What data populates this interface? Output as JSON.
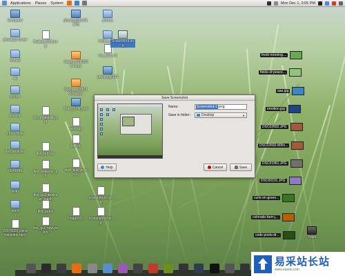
{
  "top_panel": {
    "menus": [
      "Applications",
      "Places",
      "System"
    ],
    "clock": "Mon Dec 1, 3:55 PM"
  },
  "desktop_icons": [
    {
      "label": "Computer",
      "kind": "blue"
    },
    {
      "label": "phuang's Home",
      "kind": "folder"
    },
    {
      "label": "home2",
      "kind": "folder"
    },
    {
      "label": "ali",
      "kind": "folder"
    },
    {
      "label": "google",
      "kind": "folder"
    },
    {
      "label": "new file",
      "kind": "folder"
    },
    {
      "label": "Linux Note",
      "kind": "folder"
    },
    {
      "label": "lkst_analyzer",
      "kind": "folder"
    },
    {
      "label": "README",
      "kind": "folder"
    },
    {
      "label": "WiKi",
      "kind": "folder"
    },
    {
      "label": "work",
      "kind": "folder"
    },
    {
      "label": "20070829 china transition mp3",
      "kind": "doc"
    },
    {
      "label": "Beijing-2008.png",
      "kind": "doc"
    },
    {
      "label": "Incompatibility.pdf",
      "kind": "doc"
    },
    {
      "label": "lkst_buf.csv",
      "kind": "doc"
    },
    {
      "label": "lkst_analyzer_ch",
      "kind": "doc"
    },
    {
      "label": "lkst_gui_analyzer_patch",
      "kind": "doc"
    },
    {
      "label": "lkst_patch",
      "kind": "doc"
    },
    {
      "label": "lkst_gui_new.patch",
      "kind": "doc"
    },
    {
      "label": "phuang@10.66.1.65",
      "kind": "blue"
    },
    {
      "label": "Sogou-20061102.tar.gz",
      "kind": "orange"
    },
    {
      "label": "Sogou_20061102.tar.gz",
      "kind": "orange"
    },
    {
      "label": "Start_SVN_tool",
      "kind": "blue"
    },
    {
      "label": "test.ogg",
      "kind": "doc"
    },
    {
      "label": "test.py",
      "kind": "doc"
    },
    {
      "label": "stuff_test_pywin.py",
      "kind": "doc"
    },
    {
      "label": "Tmag001...",
      "kind": "doc"
    },
    {
      "label": "photos",
      "kind": "folder"
    },
    {
      "label": "beijing_files",
      "kind": "folder"
    },
    {
      "label": "rss_test.xml",
      "kind": "doc"
    },
    {
      "label": "phuang@199",
      "kind": "blue"
    },
    {
      "label": "Screenshot.png",
      "kind": "img",
      "selected": true
    },
    {
      "label": "screenshot2.png",
      "kind": "doc"
    },
    {
      "label": "screenshot3.png",
      "kind": "doc"
    }
  ],
  "right_items": [
    {
      "label": "fresh-morning....",
      "color": "#6aa84f"
    },
    {
      "label": "fields-of-peace...",
      "color": "#93c47d"
    },
    {
      "label": "aaa.jpg",
      "color": "#3d85c6"
    },
    {
      "label": "emotion.jpg",
      "color": "#1c4587"
    },
    {
      "label": "DSC02692.JPG",
      "color": "#a05a3c"
    },
    {
      "label": "DSC02692-800x...",
      "color": "#a05a3c"
    },
    {
      "label": "DSC01961.JPG",
      "color": "#6f6f6f"
    },
    {
      "label": "DSC00101.JPG",
      "color": "#8e7cc3"
    },
    {
      "label": "curls-on-green...",
      "color": "#38761d"
    },
    {
      "label": "colorado-farm.j...",
      "color": "#b45f06"
    },
    {
      "label": "code-poets-dr...",
      "color": "#274e13"
    }
  ],
  "trash_label": "Trash",
  "dialog": {
    "title": "Save Screenshot",
    "name_label": "Name:",
    "name_selected": "Screenshot-1",
    "name_ext": ".png",
    "folder_label": "Save in folder:",
    "folder_value": "Desktop",
    "help_label": "Help",
    "cancel_label": "Cancel",
    "save_label": "Save"
  },
  "dock_items": [
    {
      "name": "dock-item-1",
      "color": "#555555"
    },
    {
      "name": "dock-item-2",
      "color": "#2b2b2b"
    },
    {
      "name": "dock-item-3",
      "color": "#3d3d3d"
    },
    {
      "name": "dock-item-firefox",
      "color": "#e66c16"
    },
    {
      "name": "dock-item-5",
      "color": "#888888"
    },
    {
      "name": "dock-item-6",
      "color": "#5b8cc7"
    },
    {
      "name": "dock-item-7",
      "color": "#9b59b6"
    },
    {
      "name": "dock-item-8",
      "color": "#444444"
    },
    {
      "name": "dock-item-9",
      "color": "#c0392b"
    },
    {
      "name": "dock-item-10",
      "color": "#6b8e23"
    },
    {
      "name": "dock-item-11",
      "color": "#333333"
    },
    {
      "name": "dock-item-12",
      "color": "#2c3e50"
    },
    {
      "name": "dock-item-13",
      "color": "#111111"
    },
    {
      "name": "dock-item-14",
      "color": "#555555"
    },
    {
      "name": "dock-item-15",
      "color": "#333333"
    }
  ],
  "watermark": {
    "text_cn": "易采站长站",
    "url": "www.easck.com"
  }
}
